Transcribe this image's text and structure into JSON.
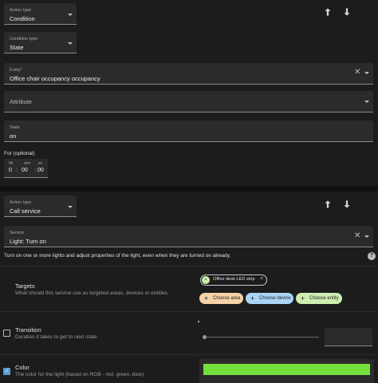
{
  "condition_card": {
    "action_type": {
      "label": "Action type",
      "value": "Condition"
    },
    "condition_type": {
      "label": "Condition type",
      "value": "State"
    },
    "entity": {
      "label": "Entity*",
      "value": "Office chair occupancy occupancy"
    },
    "attribute": {
      "placeholder": "Attribute"
    },
    "state": {
      "label": "State",
      "value": "on"
    },
    "for_label": "For (optional)",
    "duration": {
      "hh_label": "hh",
      "mm_label": "mm",
      "ss_label": "ss",
      "hh": "0",
      "mm": "00",
      "ss": "00"
    }
  },
  "service_card": {
    "action_type": {
      "label": "Action type",
      "value": "Call service"
    },
    "service": {
      "label": "Service",
      "value": "Light: Turn on"
    },
    "description": "Turn on one or more lights and adjust properties of the light, even when they are turned on already.",
    "targets": {
      "title": "Targets",
      "subtitle": "What should this service use as targeted areas, devices or entities.",
      "selected_entity": "Office desk LED strip",
      "choose_area": "Choose area",
      "choose_device": "Choose device",
      "choose_entity": "Choose entity"
    },
    "transition": {
      "title": "Transition",
      "subtitle": "Duration it takes to get to next state.",
      "checked": false
    },
    "color": {
      "title": "Color",
      "subtitle": "The color for the light (based on RGB - red, green, blue).",
      "checked": true,
      "swatch": "#76e03b"
    }
  },
  "colors": {
    "area_chip": "#f5d2a8",
    "device_chip": "#a9d4f5",
    "entity_chip": "#cdeeb0",
    "card_bg": "#1c1c1c",
    "field_bg": "#2b2b2b"
  },
  "icons": [
    "arrow-up-icon",
    "arrow-down-icon",
    "chevron-down-icon",
    "close-icon",
    "help-icon",
    "check-icon",
    "light-strip-icon"
  ]
}
